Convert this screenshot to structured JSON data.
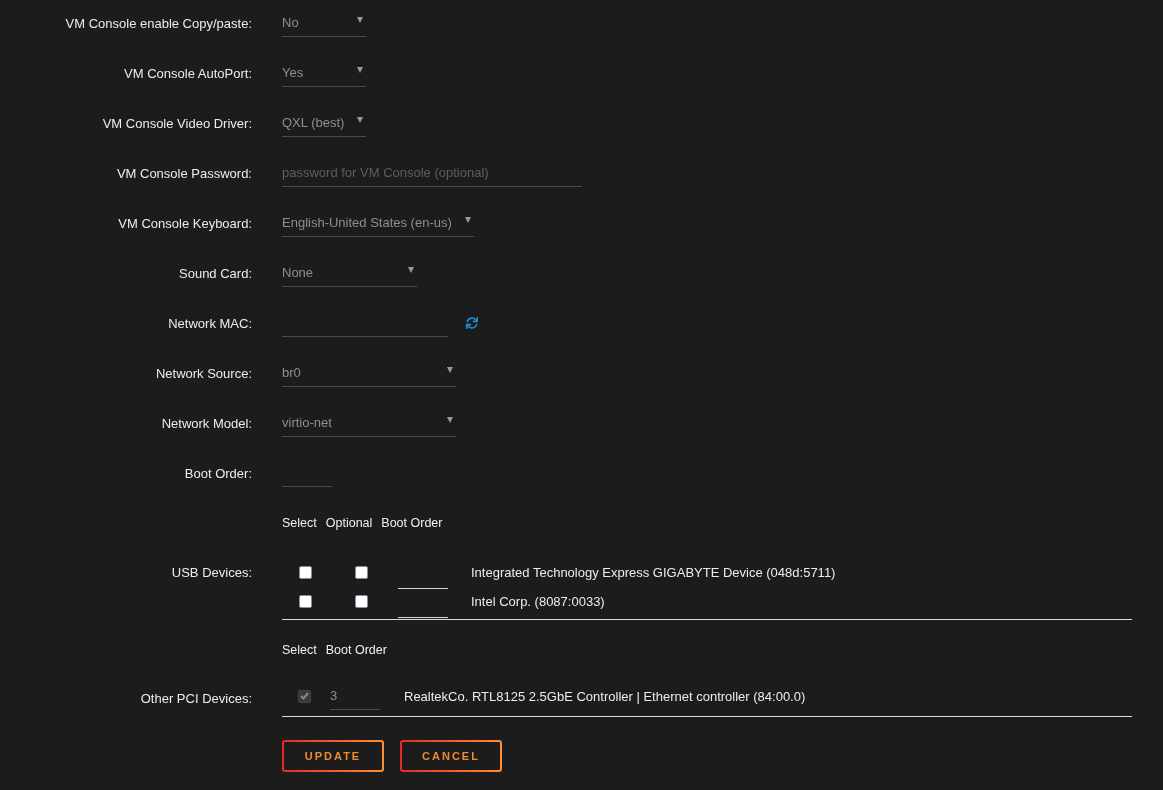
{
  "settings": [
    {
      "kind": "select",
      "label": "VM Console enable Copy/paste:",
      "value": "No"
    },
    {
      "kind": "select",
      "label": "VM Console AutoPort:",
      "value": "Yes"
    },
    {
      "kind": "select",
      "label": "VM Console Video Driver:",
      "value": "QXL (best)"
    },
    {
      "kind": "text",
      "label": "VM Console Password:",
      "placeholder": "password for VM Console (optional)"
    },
    {
      "kind": "select",
      "label": "VM Console Keyboard:",
      "value": "English-United States (en-us)"
    },
    {
      "kind": "select",
      "label": "Sound Card:",
      "value": "None"
    },
    {
      "kind": "mac",
      "label": "Network MAC:"
    },
    {
      "kind": "select",
      "label": "Network Source:",
      "value": "br0"
    },
    {
      "kind": "select",
      "label": "Network Model:",
      "value": "virtio-net"
    },
    {
      "kind": "number",
      "label": "Boot Order:"
    }
  ],
  "usb_devices": {
    "columns": [
      "Select",
      "Optional",
      "Boot Order"
    ],
    "label": "USB Devices:",
    "devices": [
      {
        "name": "Integrated Technology Express GIGABYTE Device (048d:5711)",
        "select_checked": false,
        "optional_checked": false
      },
      {
        "name": "Intel Corp. (8087:0033)",
        "select_checked": false,
        "optional_checked": false
      }
    ]
  },
  "pci_devices": {
    "columns": [
      "Select",
      "Boot Order"
    ],
    "label": "Other PCI Devices:",
    "devices": [
      {
        "name": "RealtekCo. RTL8125 2.5GbE Controller | Ethernet controller (84:00.0)",
        "checked": true,
        "disabled": true,
        "boot_order": "3"
      }
    ]
  },
  "buttons": [
    "UPDATE",
    "CANCEL"
  ]
}
